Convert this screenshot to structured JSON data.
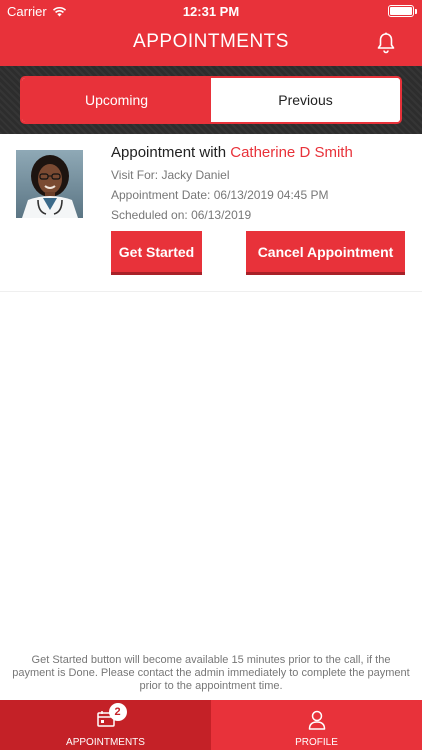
{
  "status_bar": {
    "carrier": "Carrier",
    "time": "12:31 PM",
    "battery_level": 1.0
  },
  "nav": {
    "title": "APPOINTMENTS",
    "notification_icon": "bell-icon"
  },
  "segments": {
    "upcoming": "Upcoming",
    "previous": "Previous",
    "selected": "Upcoming"
  },
  "appointment": {
    "title_prefix": "Appointment with ",
    "doctor_name": "Catherine D Smith",
    "visit_for": "Visit For: Jacky Daniel",
    "appointment_date": "Appointment Date: 06/13/2019 04:45 PM",
    "scheduled_on": "Scheduled on: 06/13/2019",
    "get_started_label": "Get Started",
    "cancel_label": "Cancel Appointment"
  },
  "notice": "Get Started button will become available 15 minutes prior to the call, if the payment is Done. Please contact the admin immediately to complete the payment prior to the appointment time.",
  "tabbar": {
    "appointments_label": "APPOINTMENTS",
    "appointments_badge": "2",
    "profile_label": "PROFILE"
  },
  "colors": {
    "primary": "#e8323a",
    "primary_dark": "#c42127",
    "segment_background": "#2d2d2d"
  }
}
